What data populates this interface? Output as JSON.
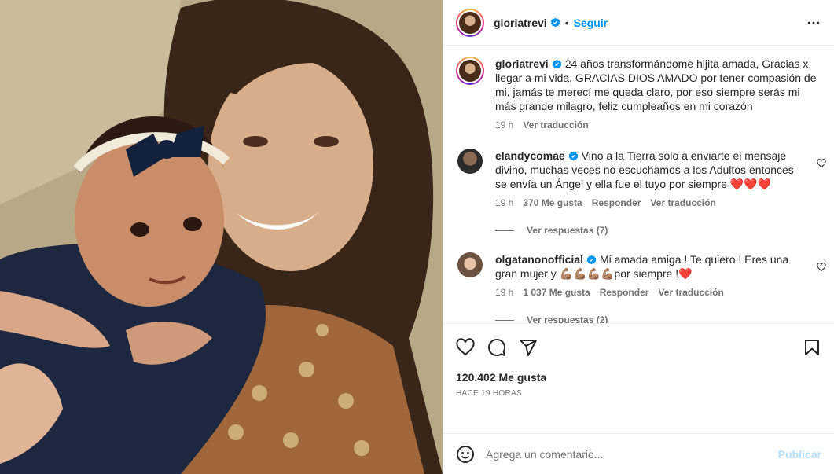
{
  "post": {
    "image_alt_icon": "photo"
  },
  "header": {
    "username": "gloriatrevi",
    "separator": "•",
    "follow_label": "Seguir",
    "more_icon": "more-horizontal-icon"
  },
  "caption": {
    "username": "gloriatrevi",
    "text": "24 años transformándome hijita amada, Gracias x llegar a mi vida, GRACIAS DIOS AMADO por tener compasión de mi, jamás te merecí me queda claro, por eso siempre serás mi más grande milagro, feliz cumpleaños en mi corazón",
    "time": "19 h",
    "translate": "Ver traducción"
  },
  "comments": [
    {
      "username": "elandycomae",
      "text": "Vino a la Tierra solo a enviarte el mensaje divino, muchas veces no escuchamos a los Adultos entonces se envía un Ángel y ella fue el tuyo por siempre ❤️❤️❤️",
      "time": "19 h",
      "likes": "370 Me gusta",
      "reply": "Responder",
      "translate": "Ver traducción",
      "view_replies": "Ver respuestas (7)"
    },
    {
      "username": "olgatanonofficial",
      "text": "Mi amada amiga ! Te quiero ! Eres una gran mujer y 💪🏽💪🏽💪🏽💪🏽por siempre !❤️",
      "time": "19 h",
      "likes": "1 037 Me gusta",
      "reply": "Responder",
      "translate": "Ver traducción",
      "view_replies": "Ver respuestas (2)"
    }
  ],
  "actions": {
    "likes_count": "120.402 Me gusta",
    "timestamp": "HACE 19 HORAS"
  },
  "add_comment": {
    "placeholder": "Agrega un comentario...",
    "publish_label": "Publicar"
  },
  "colors": {
    "accent": "#0095f6",
    "verified": "#0095f6",
    "muted": "#737373",
    "publish_disabled": "#b2dffc"
  }
}
